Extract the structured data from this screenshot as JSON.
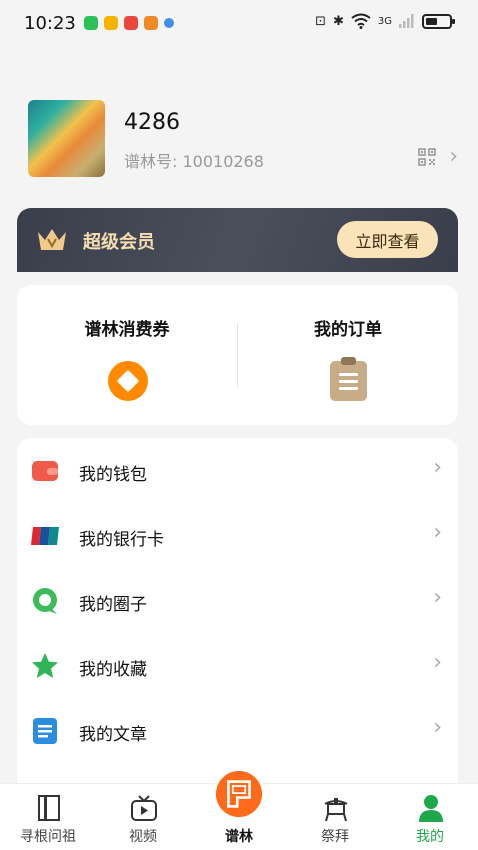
{
  "status_bar": {
    "time": "10:23",
    "network": "3G"
  },
  "profile": {
    "username": "4286",
    "user_id": "谱林号: 10010268",
    "chevron": "›"
  },
  "vip": {
    "title": "超级会员",
    "button": "立即查看"
  },
  "quick": {
    "coupon_label": "谱林消费券",
    "order_label": "我的订单"
  },
  "menu": [
    {
      "label": "我的钱包",
      "icon": "wallet-icon",
      "color": "#f05a4a"
    },
    {
      "label": "我的银行卡",
      "icon": "unionpay-icon",
      "color": "#1a6fb0"
    },
    {
      "label": "我的圈子",
      "icon": "chat-bubble-icon",
      "color": "#3dbb5a"
    },
    {
      "label": "我的收藏",
      "icon": "star-icon",
      "color": "#2fb556"
    },
    {
      "label": "我的文章",
      "icon": "article-icon",
      "color": "#2a8de0"
    }
  ],
  "tabbar": [
    {
      "label": "寻根问祖",
      "icon": "book-icon"
    },
    {
      "label": "视频",
      "icon": "tv-icon"
    },
    {
      "label": "谱林",
      "icon": "pulin-logo-icon"
    },
    {
      "label": "祭拜",
      "icon": "altar-icon"
    },
    {
      "label": "我的",
      "icon": "person-icon"
    }
  ],
  "colors": {
    "accent_green": "#1fa84a",
    "brand_orange": "#ff6a1a",
    "vip_gold": "#f6deb1"
  }
}
